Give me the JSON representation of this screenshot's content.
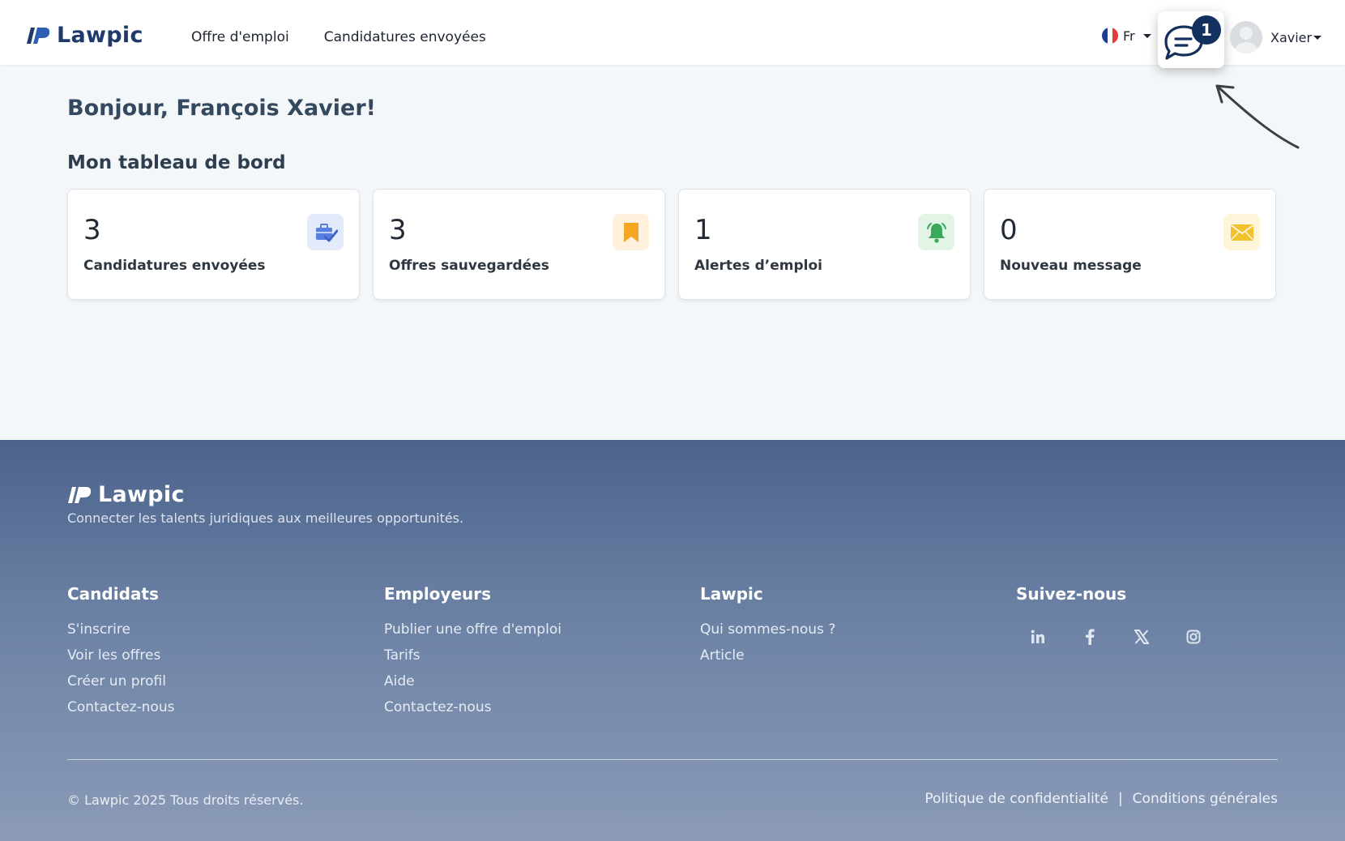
{
  "header": {
    "brand": "Lawpic",
    "nav": [
      {
        "label": "Offre d'emploi"
      },
      {
        "label": "Candidatures envoyées"
      }
    ],
    "language": {
      "label": "Fr",
      "flag": "france-flag-icon"
    },
    "chat": {
      "icon": "chat-bubble-icon",
      "badge": "1"
    },
    "user": {
      "name": "Xavier"
    }
  },
  "main": {
    "greeting": "Bonjour, François Xavier!",
    "dashboard_title": "Mon tableau de bord",
    "cards": [
      {
        "value": "3",
        "label": "Candidatures envoyées",
        "icon": "briefcase-check-icon",
        "color": "#5b7fe0",
        "bg": "#e3ebfb"
      },
      {
        "value": "3",
        "label": "Offres sauvegardées",
        "icon": "bookmark-icon",
        "color": "#f5a623",
        "bg": "#fff1dc"
      },
      {
        "value": "1",
        "label": "Alertes d’emploi",
        "icon": "bell-icon",
        "color": "#3aa95a",
        "bg": "#e1f4e6"
      },
      {
        "value": "0",
        "label": "Nouveau message",
        "icon": "envelope-icon",
        "color": "#f2c12e",
        "bg": "#fff5db"
      }
    ]
  },
  "footer": {
    "brand": "Lawpic",
    "tagline": "Connecter les talents juridiques aux meilleures opportunités.",
    "columns": [
      {
        "title": "Candidats",
        "links": [
          "S'inscrire",
          "Voir les offres",
          "Créer un profil",
          "Contactez-nous"
        ]
      },
      {
        "title": "Employeurs",
        "links": [
          "Publier une offre d'emploi",
          "Tarifs",
          "Aide",
          "Contactez-nous"
        ]
      },
      {
        "title": "Lawpic",
        "links": [
          "Qui sommes-nous ?",
          "Article"
        ]
      },
      {
        "title": "Suivez-nous",
        "socials": [
          "linkedin-icon",
          "facebook-icon",
          "x-twitter-icon",
          "instagram-icon"
        ]
      }
    ],
    "copyright": "© Lawpic 2025 Tous droits réservés.",
    "legal": [
      "Politique de confidentialité",
      "|",
      "Conditions générales"
    ]
  },
  "colors": {
    "brand": "#1e3a6b",
    "badge": "#12315e"
  }
}
